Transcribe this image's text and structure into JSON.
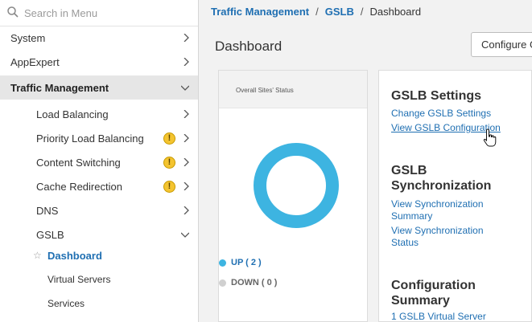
{
  "search": {
    "placeholder": "Search in Menu",
    "icon": "search-icon"
  },
  "sidebar": {
    "items": [
      {
        "label": "System"
      },
      {
        "label": "AppExpert"
      },
      {
        "label": "Traffic Management"
      },
      {
        "label": "Load Balancing"
      },
      {
        "label": "Priority Load Balancing",
        "warning": "!"
      },
      {
        "label": "Content Switching",
        "warning": "!"
      },
      {
        "label": "Cache Redirection",
        "warning": "!"
      },
      {
        "label": "DNS"
      },
      {
        "label": "GSLB"
      },
      {
        "label": "Dashboard"
      },
      {
        "label": "Virtual Servers"
      },
      {
        "label": "Services"
      }
    ]
  },
  "breadcrumb": {
    "item1": "Traffic Management",
    "item2": "GSLB",
    "current": "Dashboard",
    "separator": "/"
  },
  "page": {
    "title": "Dashboard",
    "configure_label": "Configure GSLB"
  },
  "status_card": {
    "title": "Overall Sites' Status",
    "up_label": "UP ( 2 )",
    "down_label": "DOWN ( 0 )",
    "up_count": 2,
    "down_count": 0,
    "up_color": "#3db4e1",
    "down_color": "#d0d0d0"
  },
  "settings": {
    "gslb_settings_title": "GSLB Settings",
    "change_link": "Change GSLB Settings",
    "view_link": "View GSLB Configuration",
    "sync_title_line1": "GSLB",
    "sync_title_line2": "Synchronization",
    "view_sync_summary_line1": "View Synchronization",
    "view_sync_summary_line2": "Summary",
    "view_sync_status_line1": "View Synchronization",
    "view_sync_status_line2": "Status",
    "config_summary_line1": "Configuration",
    "config_summary_line2": "Summary",
    "vserver_link": "1 GSLB Virtual Server"
  },
  "colors": {
    "accent": "#1f6fb2",
    "warning": "#f4c430",
    "active_bg": "#e6e6e6"
  }
}
